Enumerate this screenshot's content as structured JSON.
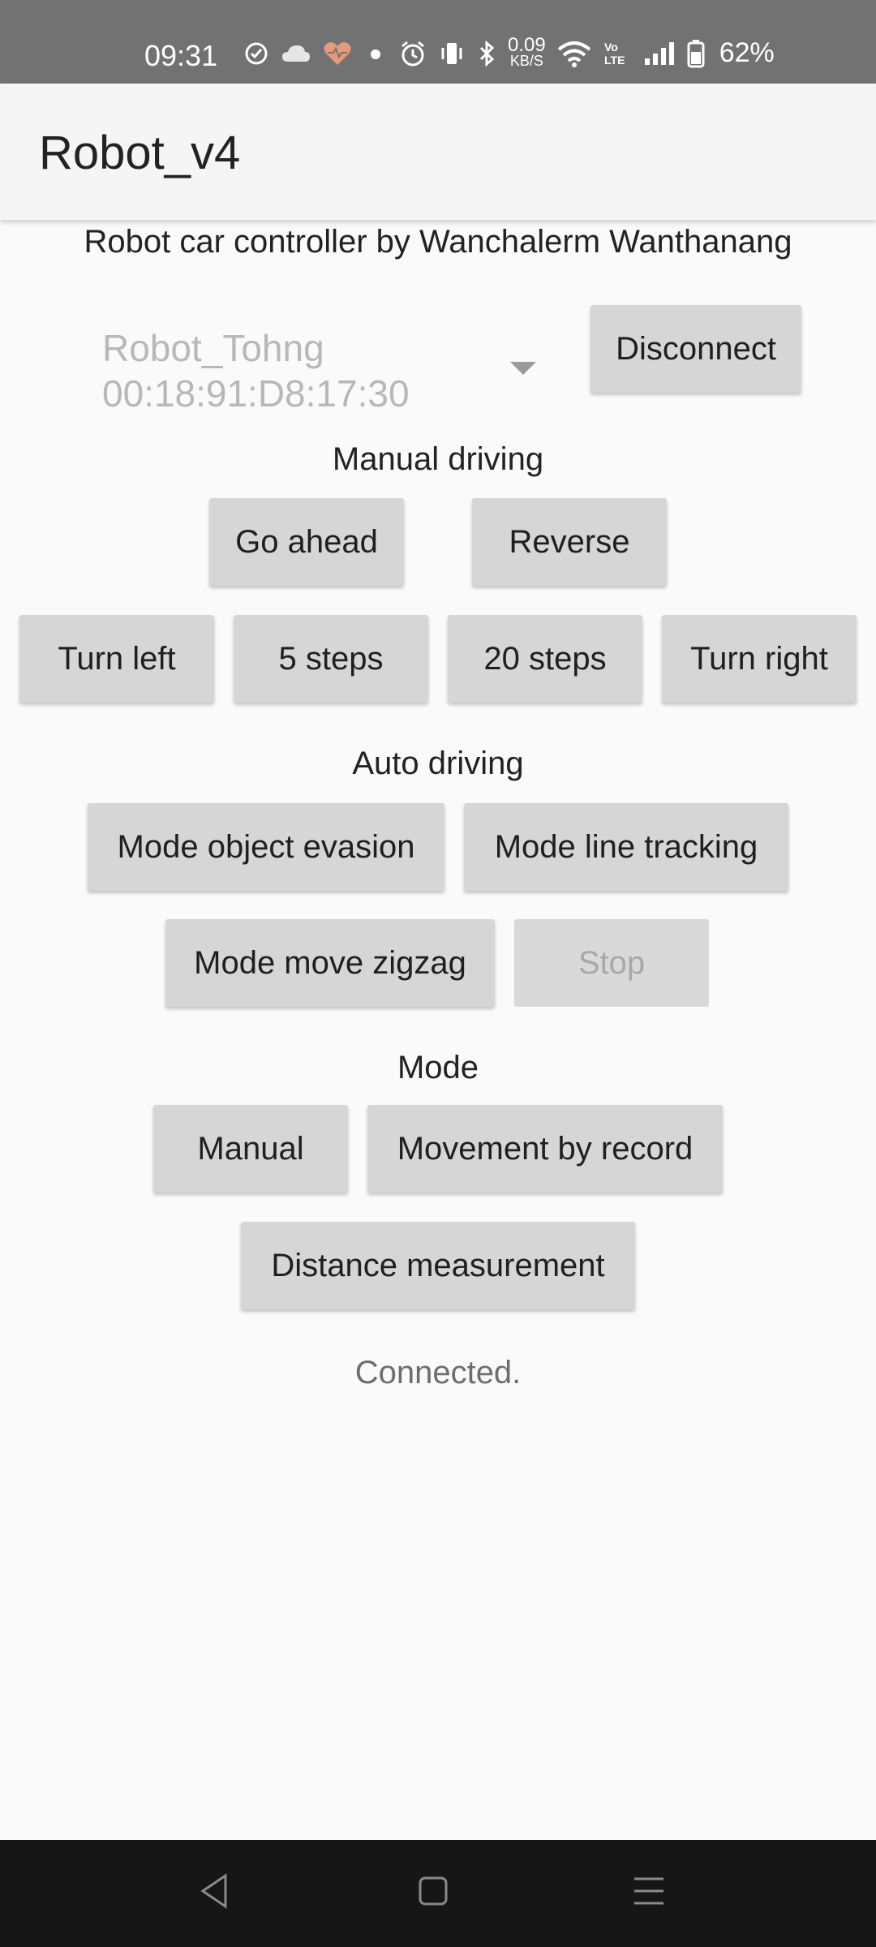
{
  "status_bar": {
    "time": "09:31",
    "network_speed_value": "0.09",
    "network_speed_unit": "KB/S",
    "battery_percent": "62%",
    "icons": [
      "check-circle-icon",
      "cloud-icon",
      "heart-pulse-icon",
      "dot-icon",
      "alarm-icon",
      "vibrate-icon",
      "bluetooth-icon",
      "wifi-icon",
      "volte-icon",
      "signal-icon",
      "battery-icon"
    ]
  },
  "app_bar": {
    "title": "Robot_v4"
  },
  "header": {
    "subtitle": "Robot car controller by Wanchalerm Wanthanang"
  },
  "device_spinner": {
    "name": "Robot_Tohng",
    "address": "00:18:91:D8:17:30"
  },
  "connection": {
    "button_label": "Disconnect"
  },
  "manual_driving": {
    "label": "Manual driving",
    "go_ahead": "Go ahead",
    "reverse": "Reverse",
    "turn_left": "Turn left",
    "five_steps": "5 steps",
    "twenty_steps": "20 steps",
    "turn_right": "Turn right"
  },
  "auto_driving": {
    "label": "Auto driving",
    "object_evasion": "Mode object evasion",
    "line_tracking": "Mode line tracking",
    "move_zigzag": "Mode move zigzag",
    "stop": "Stop"
  },
  "mode": {
    "label": "Mode",
    "manual": "Manual",
    "movement_by_record": "Movement by record",
    "distance_measurement": "Distance measurement"
  },
  "status": {
    "message": "Connected."
  },
  "colors": {
    "status_bar_bg": "#727272",
    "app_bar_bg": "#f5f5f5",
    "button_bg": "#d6d6d6",
    "page_bg": "#fafafa",
    "nav_bar_bg": "#161616",
    "heart_icon": "#e89a78"
  }
}
